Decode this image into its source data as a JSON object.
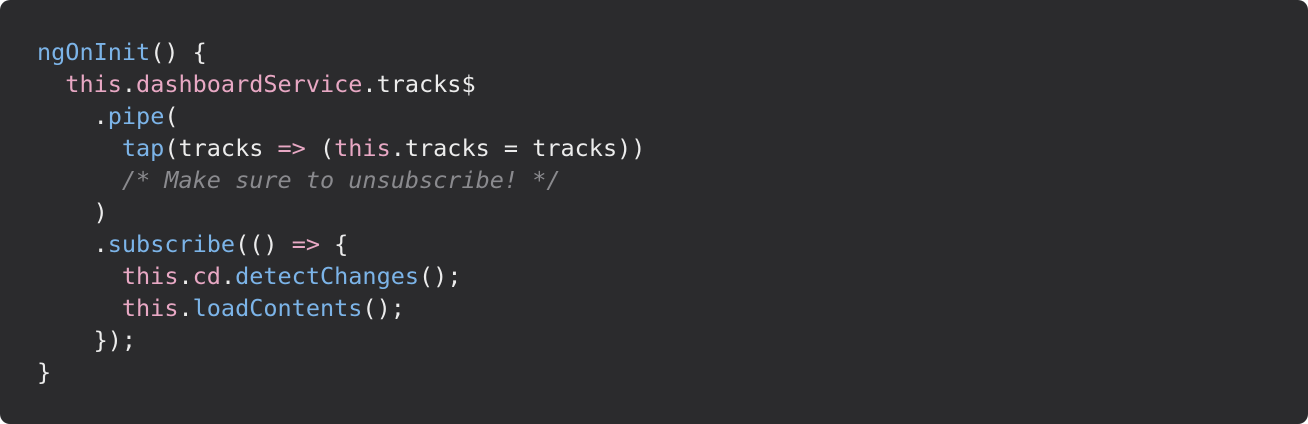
{
  "colors": {
    "background": "#2b2b2d",
    "function": "#7cb4e8",
    "keyword": "#e8a8c4",
    "plain": "#ececec",
    "comment": "#8a8a8e"
  },
  "code": {
    "lines": [
      [
        {
          "text": "ngOnInit",
          "kind": "fn"
        },
        {
          "text": "() {",
          "kind": "plain"
        }
      ],
      [
        {
          "text": "  ",
          "kind": "plain"
        },
        {
          "text": "this",
          "kind": "kw"
        },
        {
          "text": ".",
          "kind": "plain"
        },
        {
          "text": "dashboardService",
          "kind": "prop"
        },
        {
          "text": ".tracks$",
          "kind": "plain"
        }
      ],
      [
        {
          "text": "    .",
          "kind": "plain"
        },
        {
          "text": "pipe",
          "kind": "fn"
        },
        {
          "text": "(",
          "kind": "plain"
        }
      ],
      [
        {
          "text": "      ",
          "kind": "plain"
        },
        {
          "text": "tap",
          "kind": "fn"
        },
        {
          "text": "(tracks ",
          "kind": "plain"
        },
        {
          "text": "=>",
          "kind": "op"
        },
        {
          "text": " (",
          "kind": "plain"
        },
        {
          "text": "this",
          "kind": "kw"
        },
        {
          "text": ".tracks = tracks))",
          "kind": "plain"
        }
      ],
      [
        {
          "text": "      ",
          "kind": "plain"
        },
        {
          "text": "/* Make sure to unsubscribe! */",
          "kind": "comment"
        }
      ],
      [
        {
          "text": "    )",
          "kind": "plain"
        }
      ],
      [
        {
          "text": "    .",
          "kind": "plain"
        },
        {
          "text": "subscribe",
          "kind": "fn"
        },
        {
          "text": "(() ",
          "kind": "plain"
        },
        {
          "text": "=>",
          "kind": "op"
        },
        {
          "text": " {",
          "kind": "plain"
        }
      ],
      [
        {
          "text": "      ",
          "kind": "plain"
        },
        {
          "text": "this",
          "kind": "kw"
        },
        {
          "text": ".",
          "kind": "plain"
        },
        {
          "text": "cd",
          "kind": "prop"
        },
        {
          "text": ".",
          "kind": "plain"
        },
        {
          "text": "detectChanges",
          "kind": "fn"
        },
        {
          "text": "();",
          "kind": "plain"
        }
      ],
      [
        {
          "text": "      ",
          "kind": "plain"
        },
        {
          "text": "this",
          "kind": "kw"
        },
        {
          "text": ".",
          "kind": "plain"
        },
        {
          "text": "loadContents",
          "kind": "fn"
        },
        {
          "text": "();",
          "kind": "plain"
        }
      ],
      [
        {
          "text": "    });",
          "kind": "plain"
        }
      ],
      [
        {
          "text": "}",
          "kind": "plain"
        }
      ]
    ]
  }
}
